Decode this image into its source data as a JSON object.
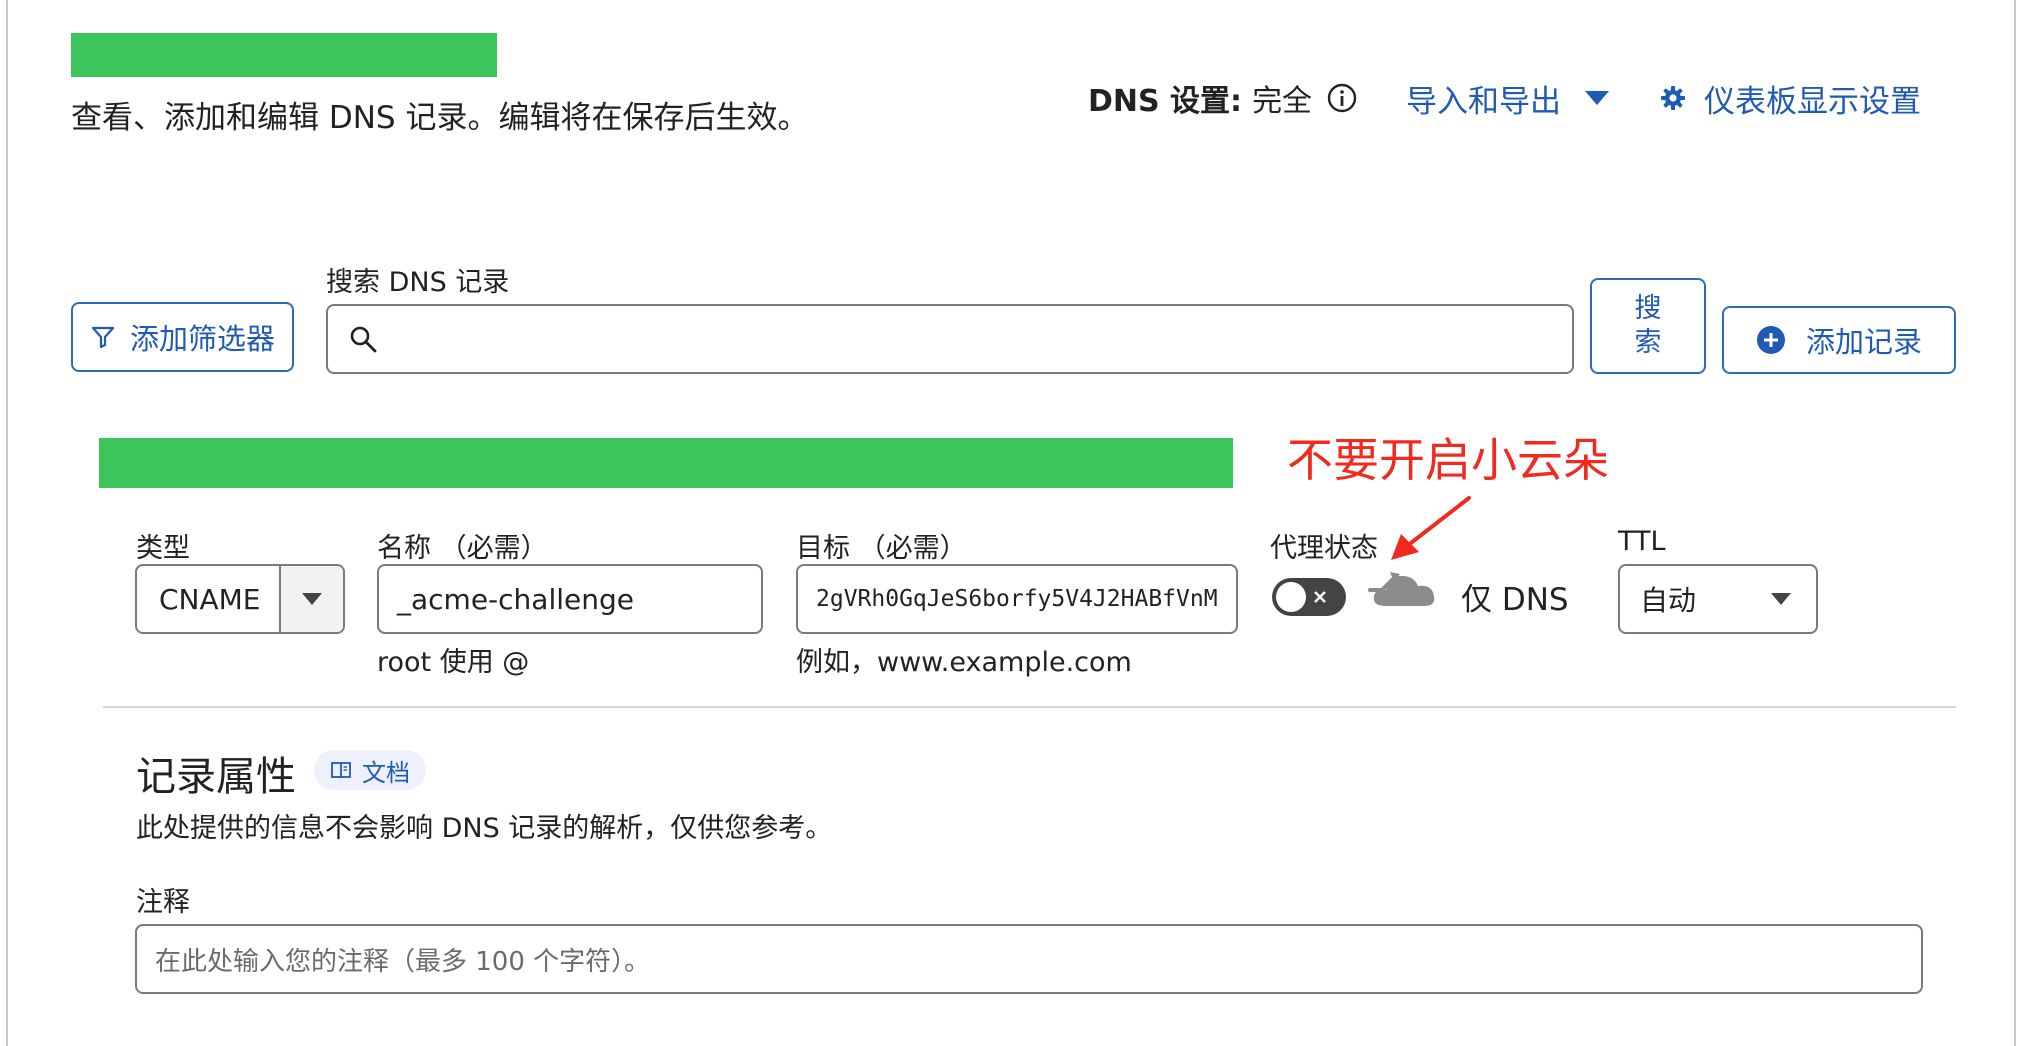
{
  "header": {
    "description": "查看、添加和编辑 DNS 记录。编辑将在保存后生效。",
    "dns_settings_label": "DNS 设置:",
    "dns_settings_value": "完全",
    "import_export_label": "导入和导出",
    "dashboard_settings_label": "仪表板显示设置"
  },
  "search": {
    "label": "搜索 DNS 记录",
    "value": "",
    "add_filter_label": "添加筛选器",
    "search_button_label": "搜索",
    "add_record_label": "添加记录"
  },
  "annotation": {
    "text": "不要开启小云朵",
    "color": "#f02a1e"
  },
  "record_form": {
    "type": {
      "label": "类型",
      "value": "CNAME"
    },
    "name": {
      "label": "名称 （必需）",
      "value": "_acme-challenge",
      "hint": "root 使用 @"
    },
    "target": {
      "label": "目标 （必需）",
      "value": "2gVRh0GqJeS6borfy5V4J2HABfVnM",
      "hint": "例如，www.example.com"
    },
    "proxy": {
      "label": "代理状态",
      "toggle_on": false,
      "status_text": "仅 DNS"
    },
    "ttl": {
      "label": "TTL",
      "value": "自动"
    }
  },
  "record_attributes": {
    "title": "记录属性",
    "docs_badge": "文档",
    "description": "此处提供的信息不会影响 DNS 记录的解析，仅供您参考。",
    "comment_label": "注释",
    "comment_placeholder": "在此处输入您的注释（最多 100 个字符）。",
    "comment_value": ""
  },
  "colors": {
    "accent": "#1f5bb5",
    "redaction": "#3cc55a"
  }
}
